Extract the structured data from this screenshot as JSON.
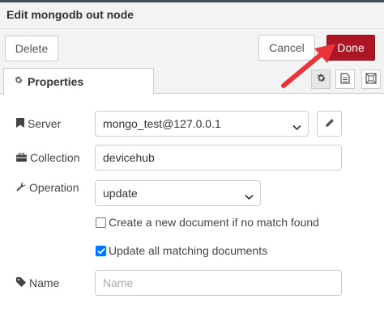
{
  "dialog": {
    "title": "Edit mongodb out node"
  },
  "toolbar": {
    "delete_label": "Delete",
    "cancel_label": "Cancel",
    "done_label": "Done"
  },
  "tabs": {
    "properties_label": "Properties",
    "icons": [
      "gear-icon",
      "description-icon",
      "appearance-icon"
    ]
  },
  "form": {
    "server": {
      "label": "Server",
      "value": "mongo_test@127.0.0.1"
    },
    "collection": {
      "label": "Collection",
      "value": "devicehub"
    },
    "operation": {
      "label": "Operation",
      "value": "update"
    },
    "upsert": {
      "label": "Create a new document if no match found",
      "checked": false
    },
    "multi": {
      "label": "Update all matching documents",
      "checked": true
    },
    "name": {
      "label": "Name",
      "value": "",
      "placeholder": "Name"
    }
  },
  "colors": {
    "done_button": "#ad1625",
    "annotation_arrow": "#e8343a",
    "checkbox_checked": "#0075ff"
  }
}
